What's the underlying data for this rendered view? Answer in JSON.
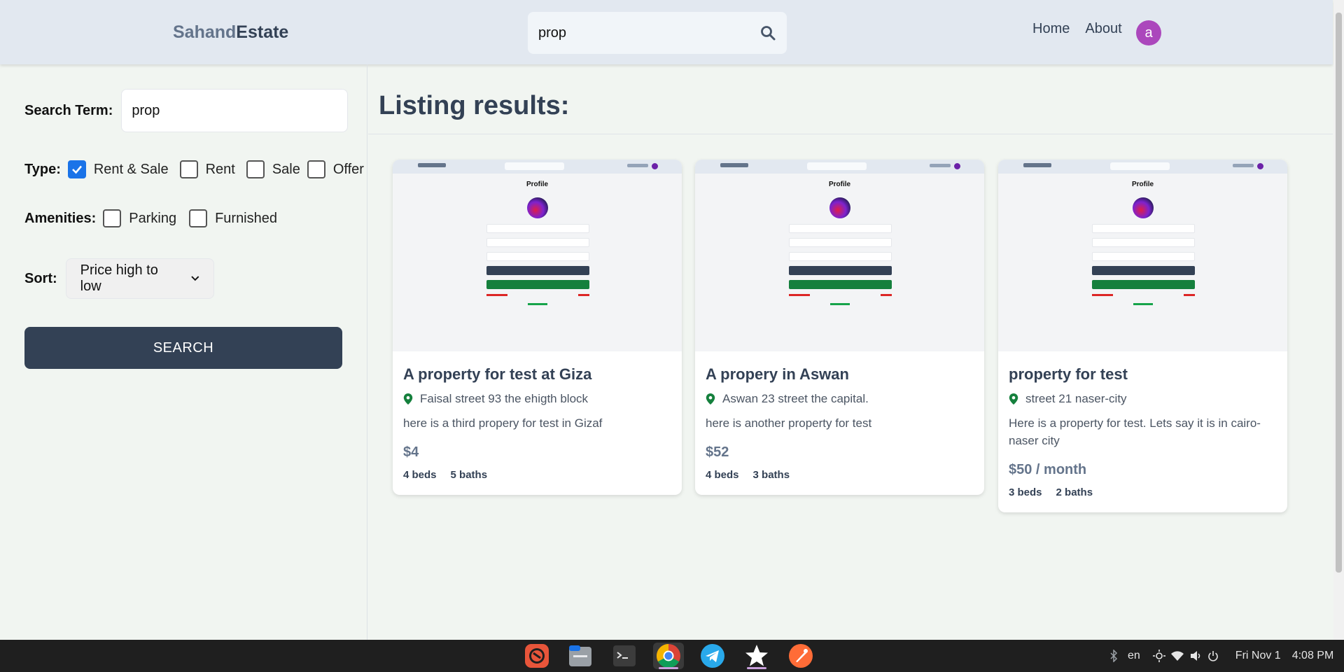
{
  "header": {
    "logo_part1": "Sahand",
    "logo_part2": "Estate",
    "search_value": "prop",
    "nav": [
      "Home",
      "About"
    ],
    "avatar_letter": "a"
  },
  "sidebar": {
    "search_term_label": "Search Term:",
    "search_term_value": "prop",
    "type_label": "Type:",
    "type_options": [
      {
        "label": "Rent & Sale",
        "checked": true
      },
      {
        "label": "Rent",
        "checked": false
      },
      {
        "label": "Sale",
        "checked": false
      },
      {
        "label": "Offer",
        "checked": false
      }
    ],
    "amenities_label": "Amenities:",
    "amenity_options": [
      {
        "label": "Parking",
        "checked": false
      },
      {
        "label": "Furnished",
        "checked": false
      }
    ],
    "sort_label": "Sort:",
    "sort_value": "Price high to low",
    "search_button": "SEARCH"
  },
  "main": {
    "title": "Listing results:",
    "listings": [
      {
        "title": "A property for test at Giza",
        "address": "Faisal street 93 the ehigth block",
        "description": "here is a third propery for test in Gizaf",
        "price": "$4",
        "beds": "4 beds",
        "baths": "5 baths",
        "thumb_title": "Profile"
      },
      {
        "title": "A propery in Aswan",
        "address": "Aswan 23 street the capital.",
        "description": "here is another property for test",
        "price": "$52",
        "beds": "4 beds",
        "baths": "3 baths",
        "thumb_title": "Profile"
      },
      {
        "title": "property for test",
        "address": "street 21 naser-city",
        "description": "Here is a property for test. Lets say it is in cairo-naser city",
        "price": "$50 / month",
        "beds": "3 beds",
        "baths": "2 baths",
        "thumb_title": "Profile"
      }
    ]
  },
  "taskbar": {
    "apps": [
      "screenshot-icon",
      "files-icon",
      "terminal-icon",
      "chrome-icon",
      "telegram-icon",
      "star-icon",
      "postman-icon"
    ],
    "language": "en",
    "date": "Fri Nov 1",
    "time": "4:08 PM"
  },
  "colors": {
    "accent_dark": "#334155",
    "checkbox_blue": "#1a73e8",
    "avatar": "#ab47bc",
    "pin_green": "#15803d"
  }
}
